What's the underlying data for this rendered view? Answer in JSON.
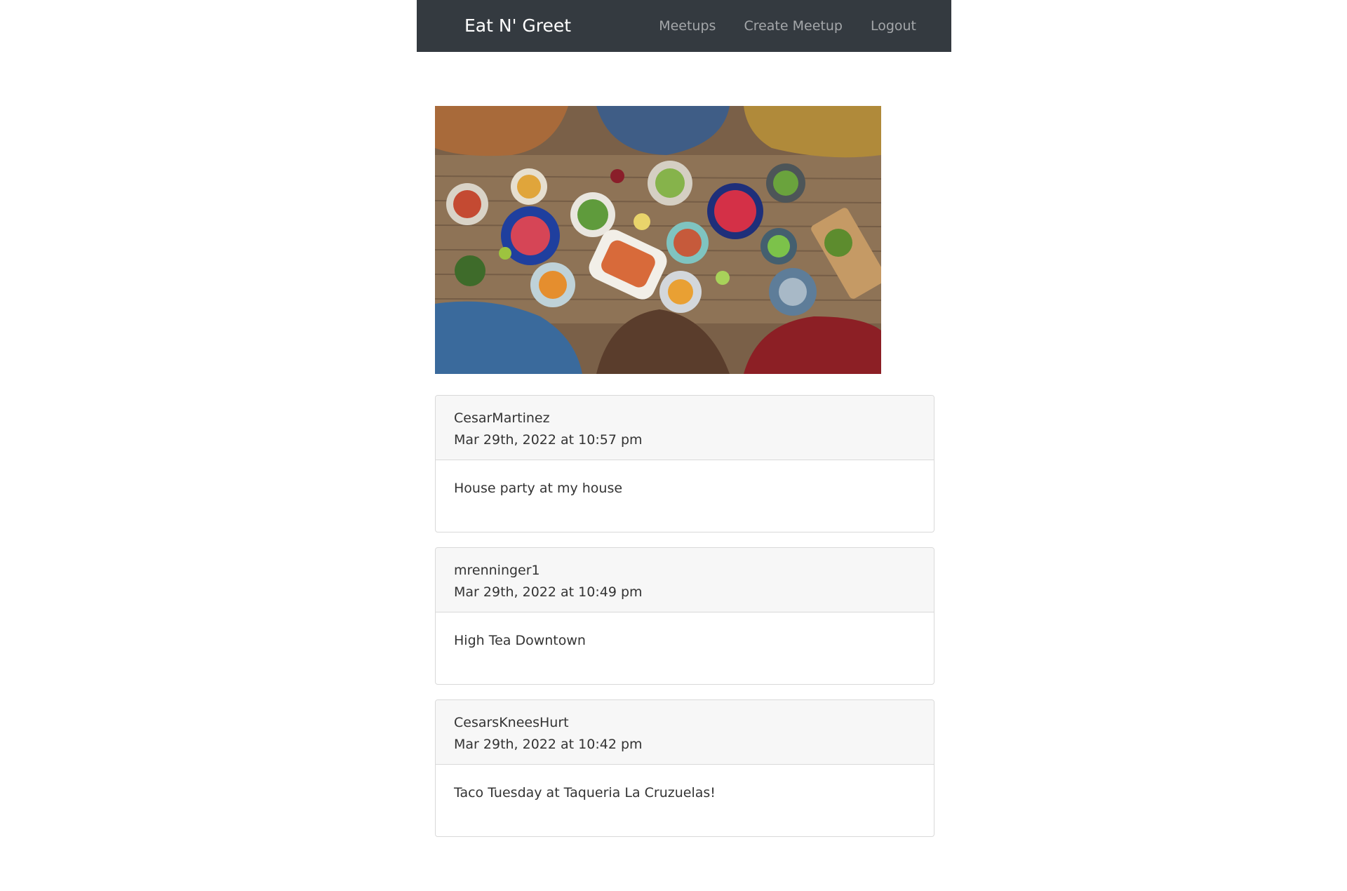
{
  "navbar": {
    "brand": "Eat N' Greet",
    "links": [
      {
        "label": "Meetups"
      },
      {
        "label": "Create Meetup"
      },
      {
        "label": "Logout"
      }
    ],
    "background": "#343a40"
  },
  "hero": {
    "image": "food-table-photo"
  },
  "meetups": [
    {
      "user": "CesarMartinez",
      "date": "Mar 29th, 2022 at 10:57 pm",
      "title": "House party at my house"
    },
    {
      "user": "mrenninger1",
      "date": "Mar 29th, 2022 at 10:49 pm",
      "title": "High Tea Downtown"
    },
    {
      "user": "CesarsKneesHurt",
      "date": "Mar 29th, 2022 at 10:42 pm",
      "title": "Taco Tuesday at Taqueria La Cruzuelas!"
    }
  ]
}
